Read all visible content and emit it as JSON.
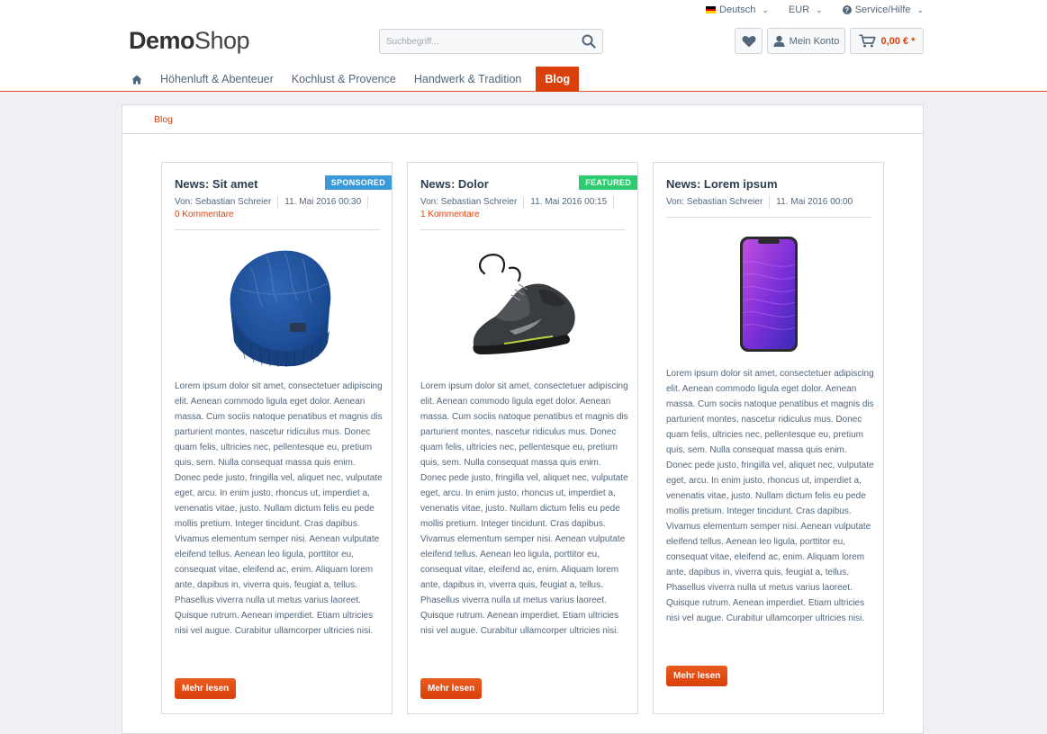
{
  "topbar": {
    "language": "Deutsch",
    "currency": "EUR",
    "service": "Service/Hilfe"
  },
  "logo": {
    "part1": "Demo",
    "part2": "Shop"
  },
  "search": {
    "placeholder": "Suchbegriff..."
  },
  "header": {
    "account_label": "Mein Konto",
    "cart_price": "0,00 € *"
  },
  "nav": {
    "items": [
      {
        "label": "Höhenluft & Abenteuer"
      },
      {
        "label": "Kochlust & Provence"
      },
      {
        "label": "Handwerk & Tradition"
      },
      {
        "label": "Blog"
      }
    ]
  },
  "breadcrumb": {
    "label": "Blog"
  },
  "posts": [
    {
      "title": "News: Sit amet",
      "badge": "SPONSORED",
      "author": "Von: Sebastian Schreier",
      "date": "11. Mai 2016 00:30",
      "comments": "0 Kommentare",
      "image": "beanie-hat-image",
      "text": "Lorem ipsum dolor sit amet, consectetuer adipiscing elit. Aenean commodo ligula eget dolor. Aenean massa. Cum sociis natoque penatibus et magnis dis parturient montes, nascetur ridiculus mus. Donec quam felis, ultricies nec, pellentesque eu, pretium quis, sem. Nulla consequat massa quis enim. Donec pede justo, fringilla vel, aliquet nec, vulputate eget, arcu. In enim justo, rhoncus ut, imperdiet a, venenatis vitae, justo. Nullam dictum felis eu pede mollis pretium. Integer tincidunt. Cras dapibus. Vivamus elementum semper nisi. Aenean vulputate eleifend tellus. Aenean leo ligula, porttitor eu, consequat vitae, eleifend ac, enim. Aliquam lorem ante, dapibus in, viverra quis, feugiat a, tellus. Phasellus viverra nulla ut metus varius laoreet. Quisque rutrum. Aenean imperdiet. Etiam ultricies nisi vel augue. Curabitur ullamcorper ultricies nisi.",
      "more": "Mehr lesen"
    },
    {
      "title": "News: Dolor",
      "badge": "FEATURED",
      "author": "Von: Sebastian Schreier",
      "date": "11. Mai 2016 00:15",
      "comments": "1 Kommentare",
      "image": "sneaker-image",
      "text": "Lorem ipsum dolor sit amet, consectetuer adipiscing elit. Aenean commodo ligula eget dolor. Aenean massa. Cum sociis natoque penatibus et magnis dis parturient montes, nascetur ridiculus mus. Donec quam felis, ultricies nec, pellentesque eu, pretium quis, sem. Nulla consequat massa quis enim. Donec pede justo, fringilla vel, aliquet nec, vulputate eget, arcu. In enim justo, rhoncus ut, imperdiet a, venenatis vitae, justo. Nullam dictum felis eu pede mollis pretium. Integer tincidunt. Cras dapibus. Vivamus elementum semper nisi. Aenean vulputate eleifend tellus. Aenean leo ligula, porttitor eu, consequat vitae, eleifend ac, enim. Aliquam lorem ante, dapibus in, viverra quis, feugiat a, tellus. Phasellus viverra nulla ut metus varius laoreet. Quisque rutrum. Aenean imperdiet. Etiam ultricies nisi vel augue. Curabitur ullamcorper ultricies nisi.",
      "more": "Mehr lesen"
    },
    {
      "title": "News: Lorem ipsum",
      "badge": "",
      "author": "Von: Sebastian Schreier",
      "date": "11. Mai 2016 00:00",
      "comments": "",
      "image": "smartphone-image",
      "text": "Lorem ipsum dolor sit amet, consectetuer adipiscing elit. Aenean commodo ligula eget dolor. Aenean massa. Cum sociis natoque penatibus et magnis dis parturient montes, nascetur ridiculus mus. Donec quam felis, ultricies nec, pellentesque eu, pretium quis, sem. Nulla consequat massa quis enim. Donec pede justo, fringilla vel, aliquet nec, vulputate eget, arcu. In enim justo, rhoncus ut, imperdiet a, venenatis vitae, justo. Nullam dictum felis eu pede mollis pretium. Integer tincidunt. Cras dapibus. Vivamus elementum semper nisi. Aenean vulputate eleifend tellus. Aenean leo ligula, porttitor eu, consequat vitae, eleifend ac, enim. Aliquam lorem ante, dapibus in, viverra quis, feugiat a, tellus. Phasellus viverra nulla ut metus varius laoreet. Quisque rutrum. Aenean imperdiet. Etiam ultricies nisi vel augue. Curabitur ullamcorper ultricies nisi.",
      "more": "Mehr lesen"
    }
  ],
  "colors": {
    "accent": "#d9400b",
    "sponsored": "#3a99d8",
    "featured": "#2ecc71",
    "text": "#52667a",
    "page_bg": "#f0f0f4"
  }
}
